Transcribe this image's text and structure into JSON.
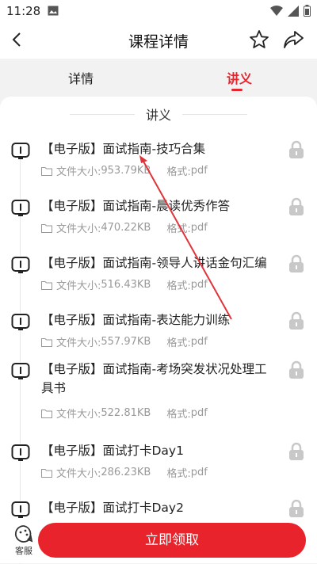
{
  "status_bar": {
    "time": "11:28"
  },
  "header": {
    "title": "课程详情"
  },
  "tabs": [
    {
      "label": "详情",
      "active": false
    },
    {
      "label": "讲义",
      "active": true
    }
  ],
  "section": {
    "title": "讲义"
  },
  "meta_labels": {
    "size_label": "文件大小:",
    "format_label": "格式:"
  },
  "materials": [
    {
      "title": "【电子版】面试指南-技巧合集",
      "size": "953.79KB",
      "format": "pdf"
    },
    {
      "title": "【电子版】面试指南-晨读优秀作答",
      "size": "470.22KB",
      "format": "pdf"
    },
    {
      "title": "【电子版】面试指南-领导人讲话金句汇编",
      "size": "516.43KB",
      "format": "pdf"
    },
    {
      "title": "【电子版】面试指南-表达能力训练",
      "size": "557.97KB",
      "format": "pdf"
    },
    {
      "title": "【电子版】面试指南-考场突发状况处理工具书",
      "size": "522.81KB",
      "format": "pdf"
    },
    {
      "title": "【电子版】面试打卡Day1",
      "size": "286.23KB",
      "format": "pdf"
    },
    {
      "title": "【电子版】面试打卡Day2",
      "size": "",
      "format": ""
    }
  ],
  "bottom": {
    "service_label": "客服",
    "claim_label": "立即领取"
  },
  "colors": {
    "accent": "#e8232c",
    "muted_text": "#999999",
    "lock": "#c8c8c8"
  }
}
